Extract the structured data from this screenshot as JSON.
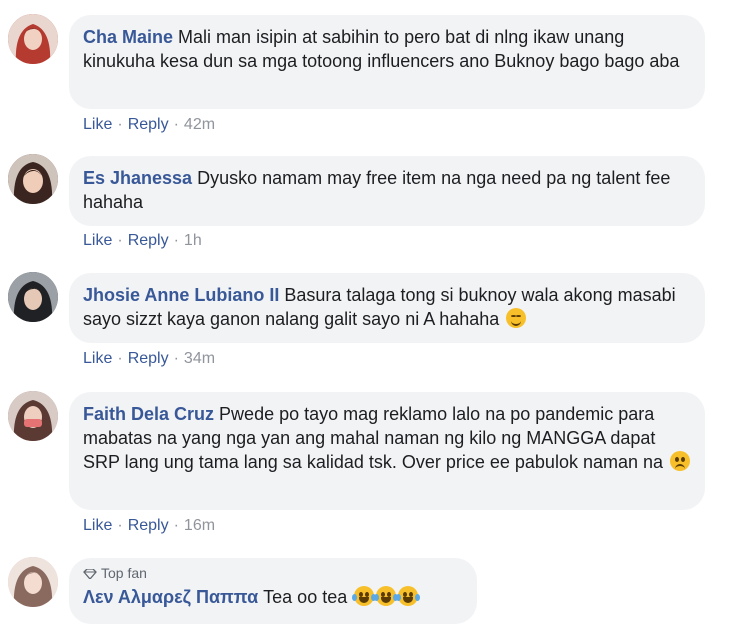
{
  "comments": [
    {
      "name": "Cha Maine",
      "text": "Mali man isipin at sabihin to pero bat di nlng ikaw unang kinukuha kesa dun sa mga totoong influencers ano Buknoy bago bago aba",
      "like": "Like",
      "reply": "Reply",
      "time": "42m",
      "avatar_color": "#c9443a"
    },
    {
      "name": "Es Jhanessa",
      "text": "Dyusko namam may free item na nga need pa ng talent fee hahaha",
      "like": "Like",
      "reply": "Reply",
      "time": "1h",
      "avatar_color": "#6b3b2e"
    },
    {
      "name": "Jhosie Anne Lubiano II",
      "text": "Basura talaga tong si buknoy wala akong masabi sayo sizzt kaya ganon nalang galit sayo ni A hahaha",
      "like": "Like",
      "reply": "Reply",
      "time": "34m",
      "avatar_color": "#3b3f44",
      "emoji": "smirk-face-icon"
    },
    {
      "name": "Faith Dela Cruz",
      "text": "Pwede po tayo mag reklamo lalo na po pandemic para mabatas na yang nga yan ang mahal naman ng kilo ng MANGGA dapat SRP lang ung tama lang sa kalidad tsk. Over price ee pabulok naman na",
      "like": "Like",
      "reply": "Reply",
      "time": "16m",
      "avatar_color": "#a7746a",
      "emoji": "sad-face-icon"
    },
    {
      "badge": "Top fan",
      "name": "Λεν Αλμαρεζ Παππα",
      "text": "Tea oo tea",
      "avatar_color": "#d9b9b0",
      "emoji": "laughing-tears-icon"
    }
  ],
  "separator": "·"
}
